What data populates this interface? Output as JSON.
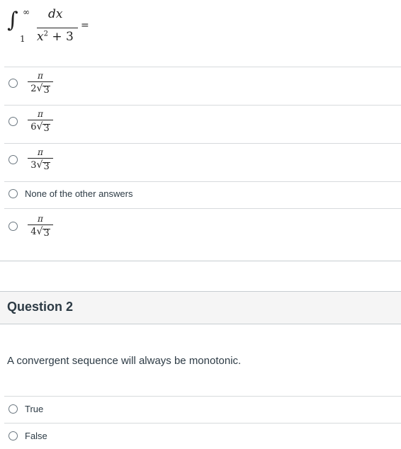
{
  "question1": {
    "integral": {
      "lower": "1",
      "upper": "∞",
      "numerator": "dx",
      "denominator_base": "x",
      "denominator_exp": "2",
      "denominator_rest": " + 3",
      "equals": "="
    },
    "answers": [
      {
        "numerator": "π",
        "coef": "2",
        "radicand": "3"
      },
      {
        "numerator": "π",
        "coef": "6",
        "radicand": "3"
      },
      {
        "numerator": "π",
        "coef": "3",
        "radicand": "3"
      },
      {
        "text": "None of the other answers"
      },
      {
        "numerator": "π",
        "coef": "4",
        "radicand": "3"
      }
    ]
  },
  "question2": {
    "title": "Question 2",
    "prompt": "A convergent sequence will always be monotonic.",
    "answers": [
      {
        "text": "True"
      },
      {
        "text": "False"
      }
    ]
  }
}
